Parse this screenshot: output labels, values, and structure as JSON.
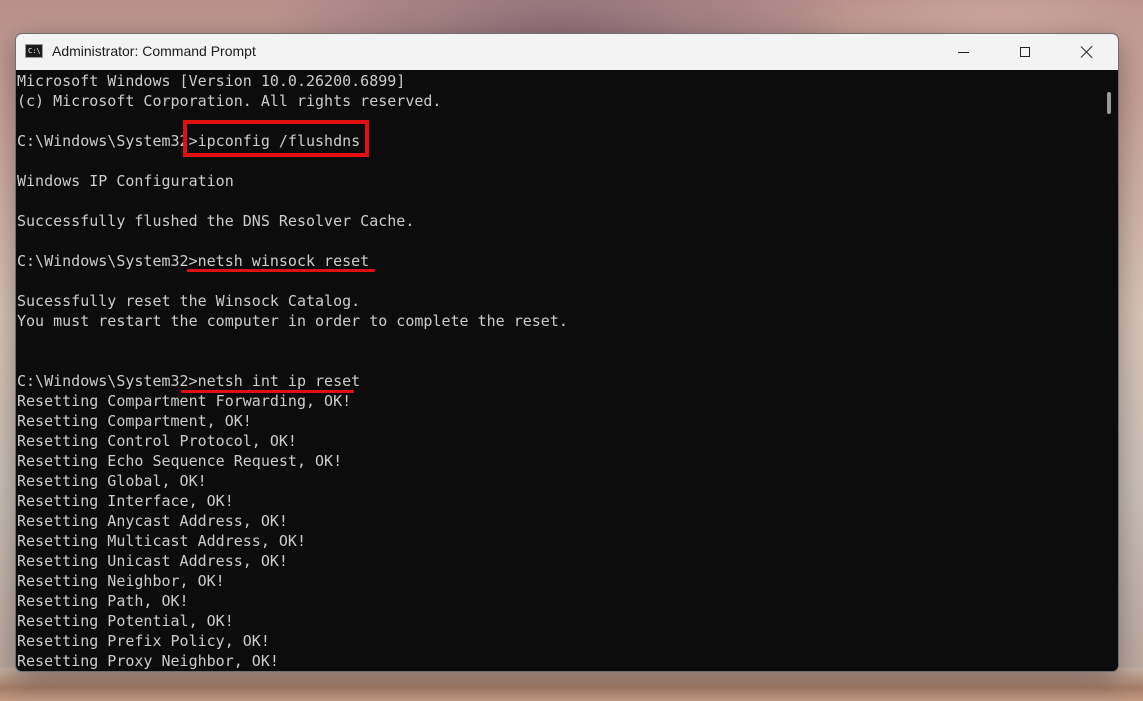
{
  "window": {
    "title": "Administrator: Command Prompt",
    "app_icon": "cmd-icon",
    "controls": [
      "minimize-icon",
      "maximize-icon",
      "close-icon"
    ]
  },
  "console": {
    "lines": [
      "Microsoft Windows [Version 10.0.26200.6899]",
      "(c) Microsoft Corporation. All rights reserved.",
      "",
      "C:\\Windows\\System32>ipconfig /flushdns",
      "",
      "Windows IP Configuration",
      "",
      "Successfully flushed the DNS Resolver Cache.",
      "",
      "C:\\Windows\\System32>netsh winsock reset",
      "",
      "Sucessfully reset the Winsock Catalog.",
      "You must restart the computer in order to complete the reset.",
      "",
      "",
      "C:\\Windows\\System32>netsh int ip reset",
      "Resetting Compartment Forwarding, OK!",
      "Resetting Compartment, OK!",
      "Resetting Control Protocol, OK!",
      "Resetting Echo Sequence Request, OK!",
      "Resetting Global, OK!",
      "Resetting Interface, OK!",
      "Resetting Anycast Address, OK!",
      "Resetting Multicast Address, OK!",
      "Resetting Unicast Address, OK!",
      "Resetting Neighbor, OK!",
      "Resetting Path, OK!",
      "Resetting Potential, OK!",
      "Resetting Prefix Policy, OK!",
      "Resetting Proxy Neighbor, OK!"
    ]
  },
  "colors": {
    "console_bg": "#0c0c0c",
    "console_text": "#cccccc",
    "annotation": "#e01010"
  }
}
